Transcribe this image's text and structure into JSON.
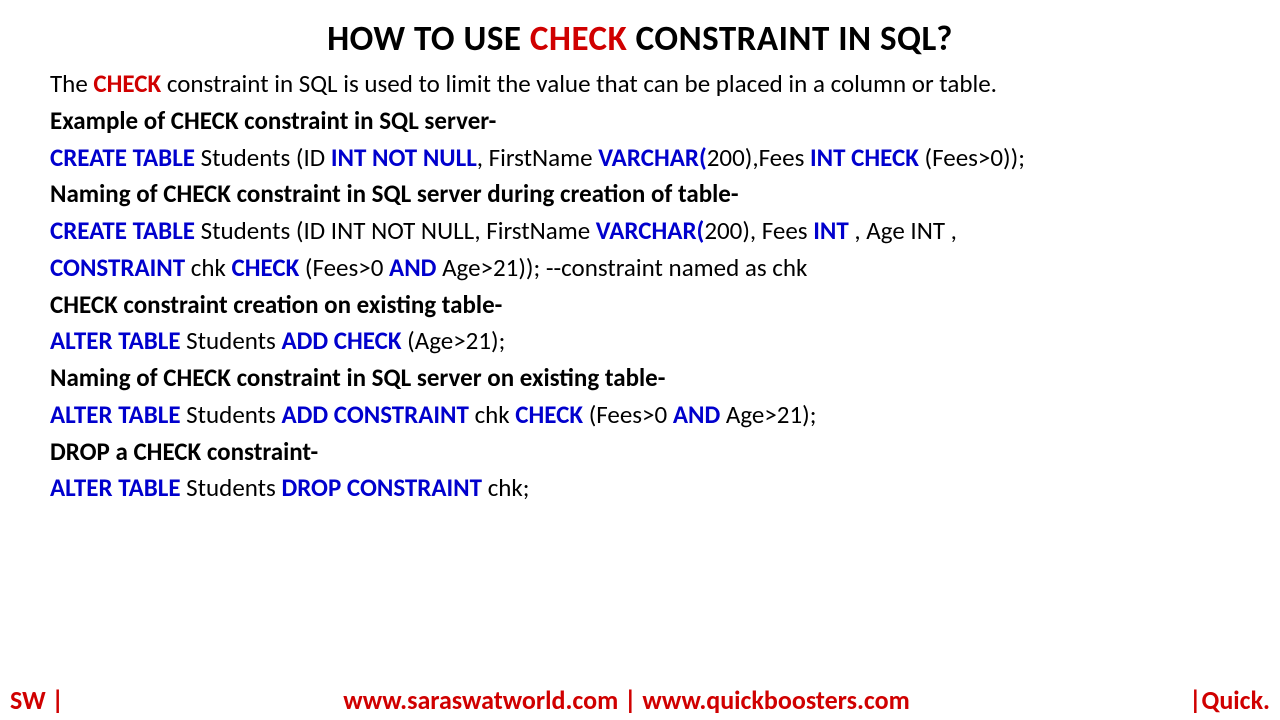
{
  "title": {
    "pre": "HOW TO USE ",
    "key": "CHECK",
    "post": " CONSTRAINT IN SQL?"
  },
  "intro": {
    "t1": "The ",
    "key": "CHECK",
    "t2": " constraint in SQL is used to limit the value that can be placed in a column or table."
  },
  "h1": "Example of CHECK constraint in SQL server-",
  "ex1": {
    "k1": "CREATE TABLE",
    "t1": " Students (ID ",
    "k2": "INT NOT NULL",
    "t2": ", FirstName ",
    "k3": "VARCHAR(",
    "t3": "200),Fees ",
    "k4": "INT CHECK",
    "t4": " (Fees>0));"
  },
  "h2": "Naming of CHECK constraint in SQL server during creation of table-",
  "ex2a": {
    "k1": "CREATE TABLE",
    "t1": " Students (ID INT NOT NULL, FirstName ",
    "k2": "VARCHAR(",
    "t2": "200), Fees ",
    "k3": "INT",
    "t3": " , Age INT ,"
  },
  "ex2b": {
    "k1": "CONSTRAINT ",
    "t1": "chk ",
    "k2": "CHECK",
    "t2": " (Fees>0 ",
    "k3": "AND",
    "t3": " Age>21));  --constraint named as chk"
  },
  "h3": "CHECK constraint creation on existing table-",
  "ex3": {
    "k1": "ALTER TABLE",
    "t1": " Students ",
    "k2": "ADD CHECK",
    "t2": " (Age>21);"
  },
  "h4": "Naming of CHECK constraint in SQL server on existing table-",
  "ex4": {
    "k1": "ALTER TABLE",
    "t1": " Students ",
    "k2": "ADD CONSTRAINT ",
    "t2": "chk ",
    "k3": "CHECK",
    "t3": " (Fees>0 ",
    "k4": "AND",
    "t4": " Age>21);"
  },
  "h5": "DROP a CHECK constraint-",
  "ex5": {
    "k1": "ALTER TABLE",
    "t1": " Students ",
    "k2": "DROP CONSTRAINT ",
    "t2": "chk;"
  },
  "footer": {
    "left": "SW |",
    "url1": "www.saraswatworld.com",
    "sep": " | ",
    "url2": "www.quickboosters.com",
    "right": "|Quick."
  }
}
